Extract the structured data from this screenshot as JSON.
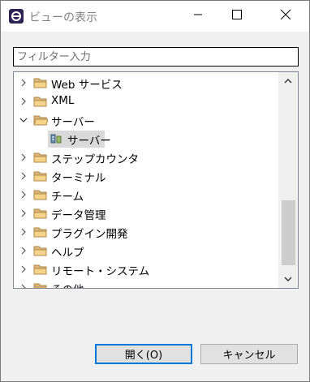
{
  "window": {
    "title": "ビューの表示"
  },
  "filter": {
    "placeholder": "フィルター入力",
    "value": ""
  },
  "tree": {
    "items": [
      {
        "label": "Web サービス",
        "expanded": false,
        "level": 0,
        "icon": "folder-icon"
      },
      {
        "label": "XML",
        "expanded": false,
        "level": 0,
        "icon": "folder-icon"
      },
      {
        "label": "サーバー",
        "expanded": true,
        "level": 0,
        "icon": "folder-icon"
      },
      {
        "label": "サーバー",
        "expanded": false,
        "level": 1,
        "icon": "server-view-icon",
        "selected": true
      },
      {
        "label": "ステップカウンタ",
        "expanded": false,
        "level": 0,
        "icon": "folder-icon"
      },
      {
        "label": "ターミナル",
        "expanded": false,
        "level": 0,
        "icon": "folder-icon"
      },
      {
        "label": "チーム",
        "expanded": false,
        "level": 0,
        "icon": "folder-icon"
      },
      {
        "label": "データ管理",
        "expanded": false,
        "level": 0,
        "icon": "folder-icon"
      },
      {
        "label": "プラグイン開発",
        "expanded": false,
        "level": 0,
        "icon": "folder-icon"
      },
      {
        "label": "ヘルプ",
        "expanded": false,
        "level": 0,
        "icon": "folder-icon"
      },
      {
        "label": "リモート・システム",
        "expanded": false,
        "level": 0,
        "icon": "folder-icon"
      },
      {
        "label": "その他",
        "expanded": false,
        "level": 0,
        "icon": "folder-icon"
      }
    ]
  },
  "buttons": {
    "open_label": "開く(O)",
    "cancel_label": "キャンセル"
  },
  "colors": {
    "accent": "#0078d7",
    "folder": "#dcb67a",
    "selection": "#d9d9d9"
  }
}
